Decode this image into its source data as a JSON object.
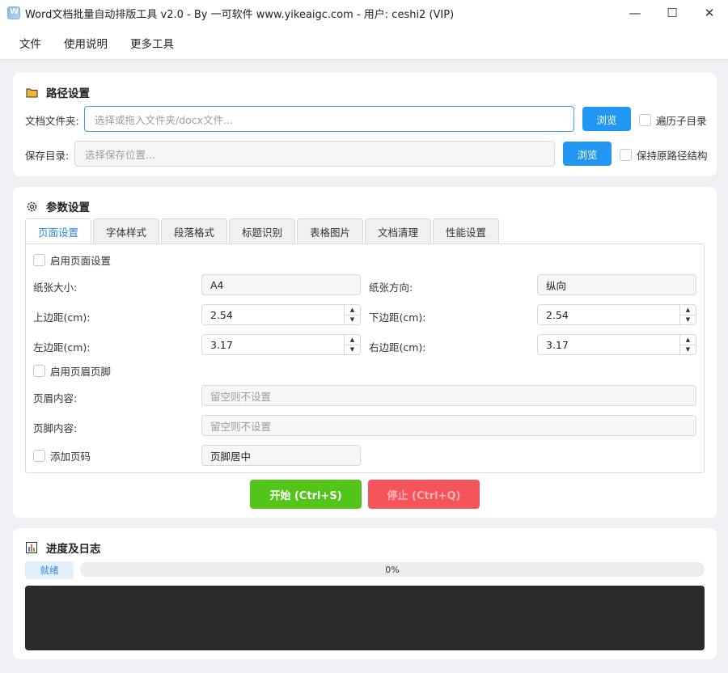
{
  "window": {
    "title": "Word文档批量自动排版工具 v2.0 - By 一可软件 www.yikeaigc.com - 用户: ceshi2 (VIP)",
    "minimize": "—",
    "maximize": "☐",
    "close": "✕"
  },
  "menu": [
    "文件",
    "使用说明",
    "更多工具"
  ],
  "path": {
    "title": "路径设置",
    "doc_label": "文档文件夹:",
    "doc_placeholder": "选择或拖入文件夹/docx文件...",
    "browse1": "浏览",
    "recurse": "遍历子目录",
    "save_label": "保存目录:",
    "save_placeholder": "选择保存位置...",
    "browse2": "浏览",
    "keep_structure": "保持原路径结构"
  },
  "params": {
    "title": "参数设置",
    "tabs": [
      "页面设置",
      "字体样式",
      "段落格式",
      "标题识别",
      "表格图片",
      "文档清理",
      "性能设置"
    ],
    "enable_page": "启用页面设置",
    "paper_size_label": "纸张大小:",
    "paper_size": "A4",
    "orientation_label": "纸张方向:",
    "orientation": "纵向",
    "top_label": "上边距(cm):",
    "top": "2.54",
    "bottom_label": "下边距(cm):",
    "bottom": "2.54",
    "left_label": "左边距(cm):",
    "left": "3.17",
    "right_label": "右边距(cm):",
    "right": "3.17",
    "enable_header": "启用页眉页脚",
    "header_label": "页眉内容:",
    "header_placeholder": "留空则不设置",
    "footer_label": "页脚内容:",
    "footer_placeholder": "留空则不设置",
    "add_page_num": "添加页码",
    "page_num_pos": "页脚居中",
    "start": "开始 (Ctrl+S)",
    "stop": "停止 (Ctrl+Q)"
  },
  "progress": {
    "title": "进度及日志",
    "status": "就绪",
    "value": 0,
    "label": "0%"
  },
  "colors": {
    "accent": "#2196f3",
    "start": "#52c41a",
    "stop": "#f5555a",
    "log_bg": "#2a2a2a"
  }
}
